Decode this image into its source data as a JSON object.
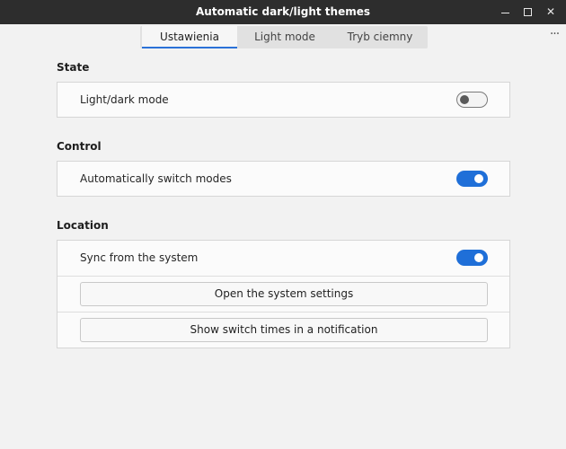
{
  "window": {
    "title": "Automatic dark/light themes",
    "controls": {
      "minimize": "minimize-icon",
      "maximize": "maximize-icon",
      "close": "close-icon"
    }
  },
  "tabs": [
    {
      "label": "Ustawienia",
      "active": true
    },
    {
      "label": "Light mode",
      "active": false
    },
    {
      "label": "Tryb ciemny",
      "active": false
    }
  ],
  "menu": {
    "more_icon": "more-options-icon"
  },
  "sections": {
    "state": {
      "title": "State",
      "rows": [
        {
          "label": "Light/dark mode",
          "toggle": false
        }
      ]
    },
    "control": {
      "title": "Control",
      "rows": [
        {
          "label": "Automatically switch modes",
          "toggle": true
        }
      ]
    },
    "location": {
      "title": "Location",
      "rows": [
        {
          "label": "Sync from the system",
          "toggle": true
        }
      ],
      "buttons": [
        "Open the system settings",
        "Show switch times in a notification"
      ]
    }
  },
  "colors": {
    "accent": "#1f6fd8",
    "titlebar": "#2d2d2d"
  }
}
